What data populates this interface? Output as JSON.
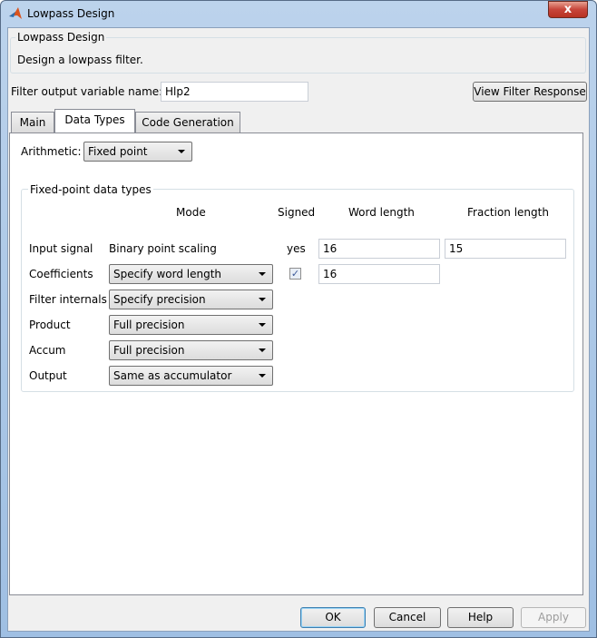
{
  "window": {
    "title": "Lowpass Design",
    "close": "x"
  },
  "header": {
    "group_title": "Lowpass Design",
    "description": "Design a lowpass filter."
  },
  "output_var": {
    "label": "Filter output variable name:",
    "value": "Hlp2"
  },
  "view_response_button": "View Filter Response",
  "tabs": [
    {
      "label": "Main"
    },
    {
      "label": "Data Types",
      "active": true
    },
    {
      "label": "Code Generation"
    }
  ],
  "arithmetic": {
    "label": "Arithmetic:",
    "value": "Fixed point"
  },
  "fixed_point": {
    "title": "Fixed-point data types",
    "columns": {
      "mode": "Mode",
      "signed": "Signed",
      "word": "Word length",
      "fraction": "Fraction length"
    },
    "rows": [
      {
        "label": "Input signal",
        "mode": "Binary point scaling",
        "signed": "yes",
        "word": "16",
        "fraction": "15"
      },
      {
        "label": "Coefficients",
        "mode": "Specify word length",
        "signed_checked": true,
        "word": "16"
      },
      {
        "label": "Filter internals",
        "mode": "Specify precision"
      },
      {
        "label": "Product",
        "mode": "Full precision"
      },
      {
        "label": "Accum",
        "mode": "Full precision"
      },
      {
        "label": "Output",
        "mode": "Same as accumulator"
      }
    ]
  },
  "buttons": {
    "ok": "OK",
    "cancel": "Cancel",
    "help": "Help",
    "apply": "Apply"
  },
  "colors": {
    "accent": "#3c7fb1",
    "close": "#c7453a"
  }
}
